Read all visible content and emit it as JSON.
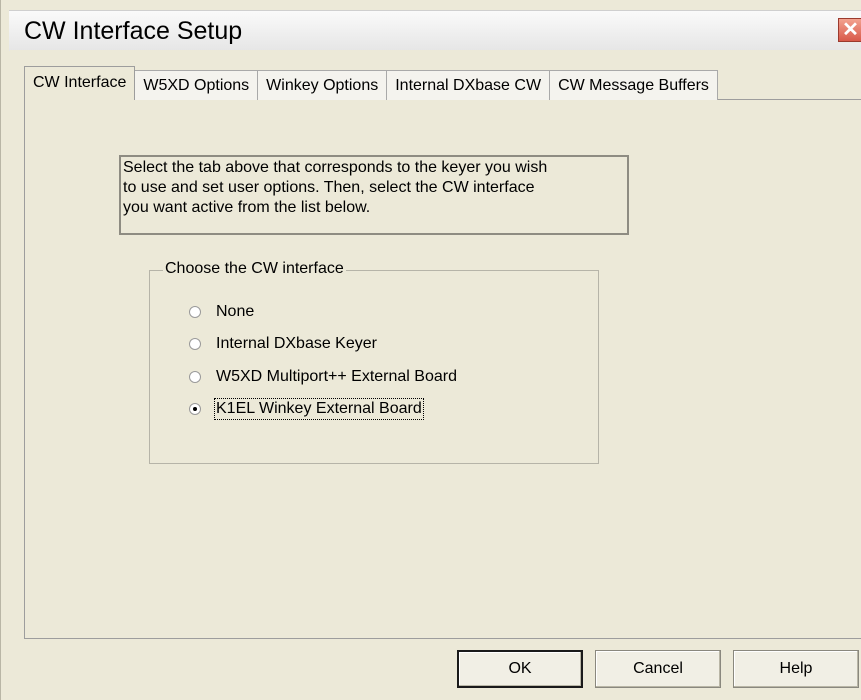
{
  "window": {
    "title": "CW Interface Setup",
    "close_glyph": "✕"
  },
  "tabs": [
    {
      "label": "CW Interface",
      "active": true
    },
    {
      "label": "W5XD Options",
      "active": false
    },
    {
      "label": "Winkey Options",
      "active": false
    },
    {
      "label": "Internal DXbase CW",
      "active": false
    },
    {
      "label": "CW Message Buffers",
      "active": false
    }
  ],
  "info": {
    "line1": "Select the tab above that corresponds to the keyer you wish",
    "line2": "to use and set user options.  Then, select the CW interface",
    "line3": "you want active from the list below."
  },
  "group": {
    "legend": "Choose the CW interface",
    "options": [
      {
        "label": "None",
        "checked": false
      },
      {
        "label": "Internal DXbase Keyer",
        "checked": false
      },
      {
        "label": "W5XD Multiport++ External Board",
        "checked": false
      },
      {
        "label": "K1EL Winkey External Board",
        "checked": true
      }
    ]
  },
  "buttons": {
    "ok": "OK",
    "cancel": "Cancel",
    "help": "Help"
  },
  "colors": {
    "dialog_bg": "#ece9d8",
    "close_button": "#d8594a"
  }
}
